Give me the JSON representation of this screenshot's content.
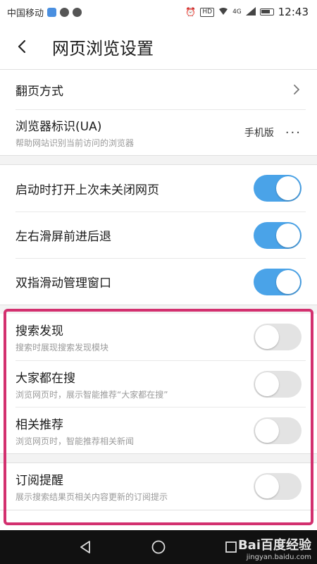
{
  "status_bar": {
    "carrier": "中国移动",
    "time": "12:43",
    "hd_badge": "HD",
    "network": "4G"
  },
  "header": {
    "title": "网页浏览设置"
  },
  "settings": {
    "page_turn": {
      "title": "翻页方式"
    },
    "ua": {
      "title": "浏览器标识(UA)",
      "desc": "帮助网站识别当前访问的浏览器",
      "value": "手机版",
      "more": "···"
    },
    "restore_tabs": {
      "title": "启动时打开上次未关闭网页",
      "enabled": true
    },
    "swipe_nav": {
      "title": "左右滑屏前进后退",
      "enabled": true
    },
    "two_finger": {
      "title": "双指滑动管理窗口",
      "enabled": true
    },
    "search_discover": {
      "title": "搜索发现",
      "desc": "搜索时展现搜索发现模块",
      "enabled": false
    },
    "everyone_search": {
      "title": "大家都在搜",
      "desc": "浏览网页时，展示智能推荐“大家都在搜”",
      "enabled": false
    },
    "related_recommend": {
      "title": "相关推荐",
      "desc": "浏览网页时，智能推荐相关新闻",
      "enabled": false
    },
    "subscription": {
      "title": "订阅提醒",
      "desc": "展示搜索结果页相关内容更新的订阅提示",
      "enabled": false
    }
  },
  "colors": {
    "toggle_on": "#4aa3e8",
    "toggle_off": "#e3e3e3",
    "highlight": "#d3306f"
  },
  "watermark": {
    "brand": "Bai百度经验",
    "url": "jingyan.baidu.com"
  }
}
